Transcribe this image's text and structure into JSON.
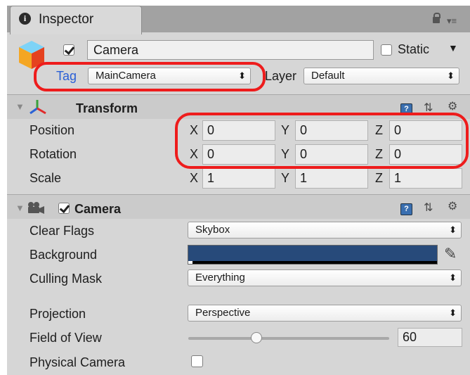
{
  "tab": {
    "title": "Inspector",
    "info_glyph": "i",
    "menu_glyph": "▾≡"
  },
  "object": {
    "name": "Camera",
    "static_label": "Static",
    "tag_label": "Tag",
    "tag_value": "MainCamera",
    "layer_label": "Layer",
    "layer_value": "Default",
    "arrow": "▼"
  },
  "transform": {
    "title": "Transform",
    "rows": [
      {
        "label": "Position",
        "x": "0",
        "y": "0",
        "z": "0"
      },
      {
        "label": "Rotation",
        "x": "0",
        "y": "0",
        "z": "0"
      },
      {
        "label": "Scale",
        "x": "1",
        "y": "1",
        "z": "1"
      }
    ],
    "axis_x": "X",
    "axis_y": "Y",
    "axis_z": "Z"
  },
  "camera": {
    "title": "Camera",
    "clear_flags_label": "Clear Flags",
    "clear_flags_value": "Skybox",
    "background_label": "Background",
    "background_color": "#274a7a",
    "culling_mask_label": "Culling Mask",
    "culling_mask_value": "Everything",
    "projection_label": "Projection",
    "projection_value": "Perspective",
    "fov_label": "Field of View",
    "fov_value": "60",
    "fov_slider_fraction": 0.34,
    "physical_camera_label": "Physical Camera"
  },
  "glyphs": {
    "updown": "⬍",
    "foldout": "▼",
    "gear": "⚙",
    "sliders": "⇅",
    "book": "?",
    "picker": "✎"
  },
  "colors": {
    "highlight": "#ee1c1c",
    "tag_blue": "#2a5fd6"
  }
}
